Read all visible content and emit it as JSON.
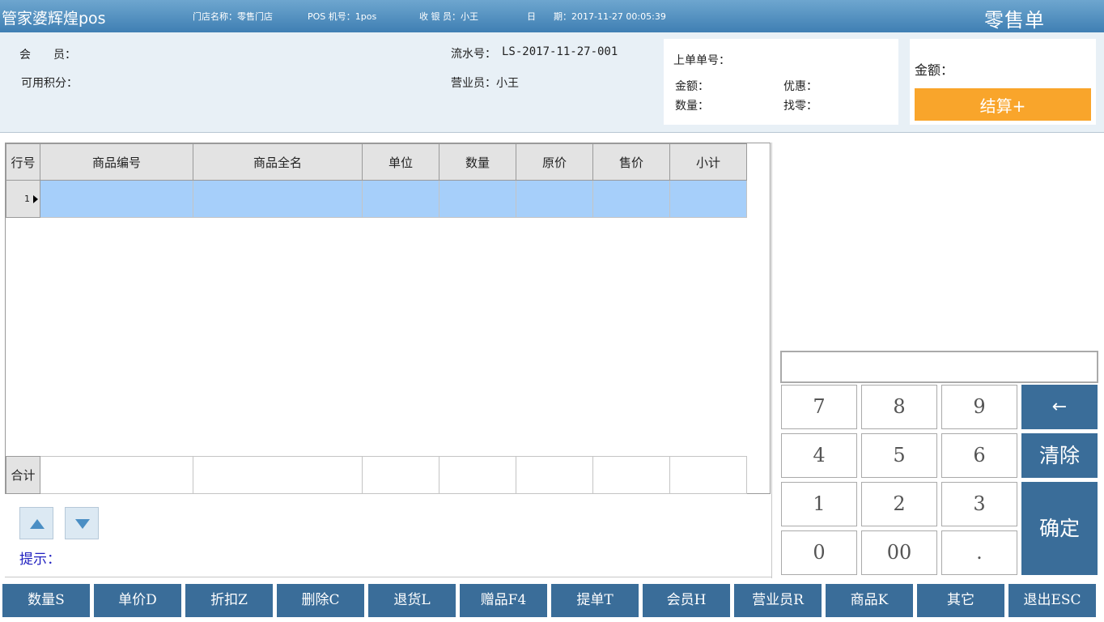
{
  "titlebar": {
    "app_title": "管家婆辉煌pos",
    "store": "门店名称：零售门店",
    "pos": "POS 机号：1pos",
    "cashier": "收 银 员：小王",
    "date": "日　　期：2017-11-27 00:05:39",
    "doc_type": "零售单"
  },
  "info": {
    "member_label": "会　　员：",
    "points_label": "可用积分：",
    "serial_label": "流水号：",
    "serial_value": "LS-2017-11-27-001",
    "clerk_label": "营业员：小王",
    "last_bill_label": "上单单号：",
    "last_amount_label": "金额：",
    "last_discount_label": "优惠：",
    "last_qty_label": "数量：",
    "last_change_label": "找零：",
    "amount_label": "金额：",
    "checkout_label": "结算+"
  },
  "grid": {
    "columns": [
      "行号",
      "商品编号",
      "商品全名",
      "单位",
      "数量",
      "原价",
      "售价",
      "小计"
    ],
    "rows": [
      {
        "row_no": "1",
        "cells": [
          "",
          "",
          "",
          "",
          "",
          "",
          ""
        ]
      }
    ],
    "total_label": "合计"
  },
  "hint_label": "提示：",
  "keypad": {
    "input_value": "",
    "keys": [
      "7",
      "8",
      "9",
      "4",
      "5",
      "6",
      "1",
      "2",
      "3",
      "0",
      "00",
      "."
    ],
    "backspace": "←",
    "clear": "清除",
    "confirm": "确定"
  },
  "functions": [
    "数量S",
    "单价D",
    "折扣Z",
    "删除C",
    "退货L",
    "赠品F4",
    "提单T",
    "会员H",
    "营业员R",
    "商品K",
    "其它",
    "退出ESC"
  ],
  "colors": {
    "titlebar_top": "#6ea6cf",
    "titlebar_bottom": "#3f7fb3",
    "panel_bg": "#e8f0f6",
    "checkout_button": "#f9a52b",
    "selected_row": "#a6cffa",
    "function_button": "#3a6d99",
    "hint_text": "#2020c0"
  }
}
